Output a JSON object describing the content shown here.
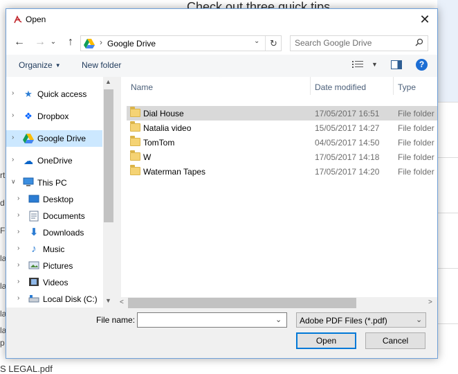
{
  "background": {
    "title": "Check out three quick tips",
    "left_fragments": [
      "rt",
      "d",
      "F",
      "la",
      "la",
      "la",
      "la",
      "p"
    ],
    "footer_text": "S LEGAL.pdf"
  },
  "dialog": {
    "title": "Open",
    "close_symbol": "✕"
  },
  "nav": {
    "back_symbol": "←",
    "forward_symbol": "→",
    "recent_symbol": "⌄",
    "up_symbol": "↑",
    "address_path": "Google Drive",
    "refresh_symbol": "↻",
    "search_placeholder": "Search Google Drive"
  },
  "toolbar": {
    "organize_label": "Organize",
    "new_folder_label": "New folder"
  },
  "nav_pane": {
    "items": [
      {
        "label": "Quick access",
        "icon": "star-icon"
      },
      {
        "label": "Dropbox",
        "icon": "dropbox-icon"
      },
      {
        "label": "Google Drive",
        "icon": "google-drive-icon"
      },
      {
        "label": "OneDrive",
        "icon": "onedrive-icon"
      },
      {
        "label": "This PC",
        "icon": "computer-icon"
      },
      {
        "label": "Desktop",
        "icon": "desktop-icon"
      },
      {
        "label": "Documents",
        "icon": "documents-icon"
      },
      {
        "label": "Downloads",
        "icon": "downloads-icon"
      },
      {
        "label": "Music",
        "icon": "music-icon"
      },
      {
        "label": "Pictures",
        "icon": "pictures-icon"
      },
      {
        "label": "Videos",
        "icon": "videos-icon"
      },
      {
        "label": "Local Disk (C:)",
        "icon": "disk-icon"
      }
    ],
    "selected": "Google Drive"
  },
  "file_list": {
    "columns": [
      "Name",
      "Date modified",
      "Type"
    ],
    "rows": [
      {
        "name": "Dial House",
        "date": "17/05/2017 16:51",
        "type": "File folder"
      },
      {
        "name": "Natalia video",
        "date": "15/05/2017 14:27",
        "type": "File folder"
      },
      {
        "name": "TomTom",
        "date": "04/05/2017 14:50",
        "type": "File folder"
      },
      {
        "name": "W",
        "date": "17/05/2017 14:18",
        "type": "File folder"
      },
      {
        "name": "Waterman Tapes",
        "date": "17/05/2017 14:20",
        "type": "File folder"
      }
    ],
    "selected_row": "Dial House"
  },
  "bottom": {
    "file_name_label": "File name:",
    "file_name_value": "",
    "file_type": "Adobe PDF Files (*.pdf)",
    "open_label": "Open",
    "cancel_label": "Cancel"
  },
  "colors": {
    "selection": "#cce8ff",
    "accent": "#0078d7",
    "folder": "#f5d374"
  }
}
